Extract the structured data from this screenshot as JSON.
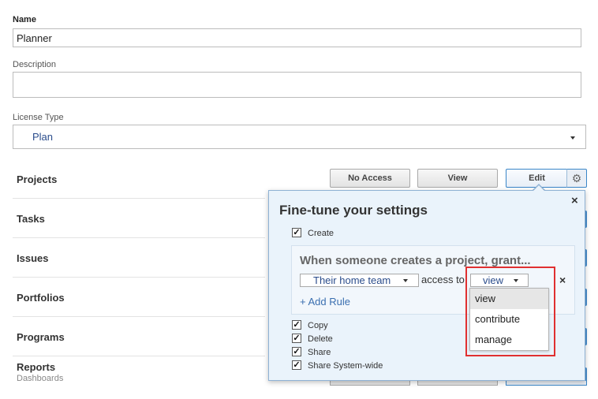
{
  "form": {
    "name_label": "Name",
    "name_value": "Planner",
    "description_label": "Description",
    "description_value": "",
    "license_label": "License Type",
    "license_value": "Plan"
  },
  "rows": [
    {
      "label": "Projects"
    },
    {
      "label": "Tasks"
    },
    {
      "label": "Issues"
    },
    {
      "label": "Portfolios"
    },
    {
      "label": "Programs"
    },
    {
      "label": "Reports",
      "sublabel": "Dashboards"
    }
  ],
  "access_buttons": {
    "no_access": "No Access",
    "view": "View",
    "edit": "Edit",
    "selected": "Edit"
  },
  "popover": {
    "title": "Fine-tune your settings",
    "close_glyph": "×",
    "create_label": "Create",
    "create_checked": true,
    "rule": {
      "heading": "When someone creates a project, grant...",
      "team_value": "Their home team",
      "access_text": "access to",
      "level_value": "view",
      "remove_glyph": "×",
      "add_rule_label": "+ Add Rule"
    },
    "dropdown": {
      "options": [
        "view",
        "contribute",
        "manage"
      ],
      "highlighted": "view"
    },
    "options": [
      {
        "label": "Copy",
        "checked": true
      },
      {
        "label": "Delete",
        "checked": true
      },
      {
        "label": "Share",
        "checked": true
      },
      {
        "label": "Share System-wide",
        "checked": true
      }
    ]
  },
  "colors": {
    "accent": "#3a86c8",
    "popover_bg": "#eaf3fb",
    "highlight_border": "#e03030",
    "link_text": "#2b4d8c"
  },
  "icons": {
    "gear": "gear-icon",
    "close": "close-icon",
    "check": "checkmark-icon",
    "caret": "chevron-down-icon"
  }
}
